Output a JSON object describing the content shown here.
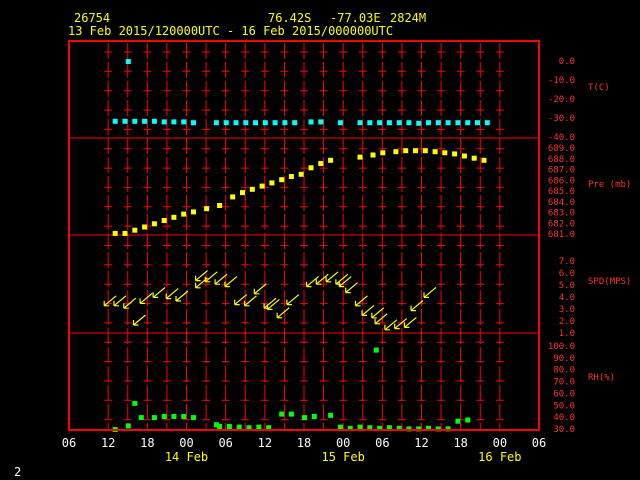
{
  "header": {
    "station_id": "26754",
    "lat": "76.42S",
    "lon": "-77.03E",
    "elev": "2824M",
    "time_range": "13 Feb 2015/120000UTC - 16 Feb 2015/000000UTC"
  },
  "footer": {
    "page_number": "2"
  },
  "colors": {
    "background": "#000000",
    "frame": "#ff0000",
    "labels": "#ff3030",
    "temperature": "#00ffff",
    "pressure": "#ffff00",
    "wind": "#ffff00",
    "humidity": "#00ff00",
    "header": "#ffff00",
    "x_ticks": "#ffffff"
  },
  "chart_data": {
    "type": "scatter",
    "x_tick_labels": [
      "06",
      "12",
      "18",
      "00",
      "06",
      "12",
      "18",
      "00",
      "06",
      "12",
      "18",
      "00",
      "06"
    ],
    "x_tick_hours": [
      6,
      12,
      18,
      24,
      30,
      36,
      42,
      48,
      54,
      60,
      66,
      72,
      78
    ],
    "x_units": "hours since 13 Feb 2015 00UTC",
    "date_labels": [
      {
        "text": "14 Feb",
        "hour": 24
      },
      {
        "text": "15 Feb",
        "hour": 48
      },
      {
        "text": "16 Feb",
        "hour": 72
      }
    ],
    "grid_hours": [
      12,
      15,
      18,
      21,
      24,
      27,
      30,
      33,
      36,
      39,
      42,
      45,
      48,
      51,
      54,
      57,
      60,
      63,
      66,
      69,
      72
    ],
    "panels": [
      {
        "key": "temperature",
        "label": "T(C)",
        "ticks": [
          "0.0",
          "-10.0",
          "-20.0",
          "-30.0",
          "-40.0"
        ],
        "ylim": [
          -40,
          0
        ],
        "marker": "square",
        "points": [
          {
            "x": 15,
            "y": 0
          },
          {
            "x": 13,
            "y": -31.5
          },
          {
            "x": 14.5,
            "y": -31.5
          },
          {
            "x": 16,
            "y": -31.5
          },
          {
            "x": 17.5,
            "y": -31.5
          },
          {
            "x": 19,
            "y": -31.5
          },
          {
            "x": 20.5,
            "y": -31.8
          },
          {
            "x": 22,
            "y": -31.8
          },
          {
            "x": 23.5,
            "y": -31.8
          },
          {
            "x": 25,
            "y": -32.2
          },
          {
            "x": 28.5,
            "y": -32.2
          },
          {
            "x": 30,
            "y": -32.2
          },
          {
            "x": 31.5,
            "y": -32.2
          },
          {
            "x": 33,
            "y": -32.2
          },
          {
            "x": 34.5,
            "y": -32.2
          },
          {
            "x": 36,
            "y": -32.2
          },
          {
            "x": 37.5,
            "y": -32.2
          },
          {
            "x": 39,
            "y": -32.2
          },
          {
            "x": 40.5,
            "y": -32.2
          },
          {
            "x": 43,
            "y": -31.8
          },
          {
            "x": 44.5,
            "y": -31.8
          },
          {
            "x": 47.5,
            "y": -32.2
          },
          {
            "x": 50.5,
            "y": -32.2
          },
          {
            "x": 52,
            "y": -32.2
          },
          {
            "x": 53.5,
            "y": -32.2
          },
          {
            "x": 55,
            "y": -32.2
          },
          {
            "x": 56.5,
            "y": -32.2
          },
          {
            "x": 58,
            "y": -32.2
          },
          {
            "x": 59.5,
            "y": -32.5
          },
          {
            "x": 61,
            "y": -32.2
          },
          {
            "x": 62.5,
            "y": -32.2
          },
          {
            "x": 64,
            "y": -32.2
          },
          {
            "x": 65.5,
            "y": -32.2
          },
          {
            "x": 67,
            "y": -32.2
          },
          {
            "x": 68.5,
            "y": -32.2
          },
          {
            "x": 70,
            "y": -32.2
          }
        ]
      },
      {
        "key": "pressure",
        "label": "Pre (mb)",
        "ticks": [
          "689.0",
          "688.0",
          "687.0",
          "686.0",
          "685.0",
          "684.0",
          "683.0",
          "682.0",
          "681.0"
        ],
        "ylim": [
          681,
          689
        ],
        "marker": "square",
        "points": [
          {
            "x": 13,
            "y": 681.1
          },
          {
            "x": 14.5,
            "y": 681.1
          },
          {
            "x": 16,
            "y": 681.4
          },
          {
            "x": 17.5,
            "y": 681.7
          },
          {
            "x": 19,
            "y": 682.0
          },
          {
            "x": 20.5,
            "y": 682.3
          },
          {
            "x": 22,
            "y": 682.6
          },
          {
            "x": 23.5,
            "y": 682.9
          },
          {
            "x": 25,
            "y": 683.1
          },
          {
            "x": 27,
            "y": 683.4
          },
          {
            "x": 29,
            "y": 683.7
          },
          {
            "x": 31,
            "y": 684.5
          },
          {
            "x": 32.5,
            "y": 684.9
          },
          {
            "x": 34,
            "y": 685.2
          },
          {
            "x": 35.5,
            "y": 685.5
          },
          {
            "x": 37,
            "y": 685.8
          },
          {
            "x": 38.5,
            "y": 686.1
          },
          {
            "x": 40,
            "y": 686.4
          },
          {
            "x": 41.5,
            "y": 686.6
          },
          {
            "x": 43,
            "y": 687.2
          },
          {
            "x": 44.5,
            "y": 687.6
          },
          {
            "x": 46,
            "y": 687.9
          },
          {
            "x": 50.5,
            "y": 688.2
          },
          {
            "x": 52.5,
            "y": 688.4
          },
          {
            "x": 54,
            "y": 688.6
          },
          {
            "x": 56,
            "y": 688.7
          },
          {
            "x": 57.5,
            "y": 688.8
          },
          {
            "x": 59,
            "y": 688.8
          },
          {
            "x": 60.5,
            "y": 688.8
          },
          {
            "x": 62,
            "y": 688.7
          },
          {
            "x": 63.5,
            "y": 688.6
          },
          {
            "x": 65,
            "y": 688.5
          },
          {
            "x": 66.5,
            "y": 688.3
          },
          {
            "x": 68,
            "y": 688.1
          },
          {
            "x": 69.5,
            "y": 687.9
          }
        ]
      },
      {
        "key": "wind",
        "label": "SPD(MPS)",
        "ticks": [
          "7.0",
          "6.0",
          "5.0",
          "4.0",
          "3.0",
          "2.0",
          "1.0"
        ],
        "ylim": [
          1,
          8
        ],
        "marker": "arrow",
        "points": [
          {
            "x": 12,
            "y": 3.6
          },
          {
            "x": 13.5,
            "y": 3.6
          },
          {
            "x": 15,
            "y": 3.4
          },
          {
            "x": 16.5,
            "y": 2.0
          },
          {
            "x": 17.5,
            "y": 3.8
          },
          {
            "x": 19.5,
            "y": 4.3
          },
          {
            "x": 21.5,
            "y": 4.2
          },
          {
            "x": 23,
            "y": 4.0
          },
          {
            "x": 26,
            "y": 5.7
          },
          {
            "x": 26,
            "y": 5.1
          },
          {
            "x": 27.5,
            "y": 5.6
          },
          {
            "x": 29,
            "y": 5.4
          },
          {
            "x": 30.5,
            "y": 5.2
          },
          {
            "x": 32,
            "y": 3.7
          },
          {
            "x": 33.5,
            "y": 3.6
          },
          {
            "x": 35,
            "y": 4.6
          },
          {
            "x": 36.5,
            "y": 3.4
          },
          {
            "x": 37,
            "y": 3.3
          },
          {
            "x": 38.5,
            "y": 2.6
          },
          {
            "x": 40,
            "y": 3.7
          },
          {
            "x": 43,
            "y": 5.2
          },
          {
            "x": 44.5,
            "y": 5.4
          },
          {
            "x": 46,
            "y": 5.6
          },
          {
            "x": 47.5,
            "y": 5.4
          },
          {
            "x": 48,
            "y": 5.2
          },
          {
            "x": 49,
            "y": 4.7
          },
          {
            "x": 50.5,
            "y": 3.6
          },
          {
            "x": 51.5,
            "y": 2.8
          },
          {
            "x": 53,
            "y": 2.6
          },
          {
            "x": 53.5,
            "y": 2.1
          },
          {
            "x": 55,
            "y": 1.6
          },
          {
            "x": 56.5,
            "y": 1.7
          },
          {
            "x": 58,
            "y": 1.8
          },
          {
            "x": 59,
            "y": 3.2
          },
          {
            "x": 61,
            "y": 4.3
          }
        ]
      },
      {
        "key": "humidity",
        "label": "RH(%)",
        "ticks": [
          "100.0",
          "90.0",
          "80.0",
          "70.0",
          "60.0",
          "50.0",
          "40.0",
          "30.0"
        ],
        "ylim": [
          30,
          100
        ],
        "marker": "square",
        "points": [
          {
            "x": 13,
            "y": 30.0
          },
          {
            "x": 15,
            "y": 33.0
          },
          {
            "x": 16,
            "y": 52.0
          },
          {
            "x": 17,
            "y": 40.0
          },
          {
            "x": 19,
            "y": 40.0
          },
          {
            "x": 20.5,
            "y": 41.0
          },
          {
            "x": 22,
            "y": 41.0
          },
          {
            "x": 23.5,
            "y": 41.0
          },
          {
            "x": 25,
            "y": 40.0
          },
          {
            "x": 28.5,
            "y": 34.0
          },
          {
            "x": 29,
            "y": 32.5
          },
          {
            "x": 30.5,
            "y": 32.5
          },
          {
            "x": 32,
            "y": 32.0
          },
          {
            "x": 33.5,
            "y": 31.5
          },
          {
            "x": 35,
            "y": 32.0
          },
          {
            "x": 36.5,
            "y": 31.5
          },
          {
            "x": 38.5,
            "y": 43.0
          },
          {
            "x": 40,
            "y": 43.0
          },
          {
            "x": 42,
            "y": 40.0
          },
          {
            "x": 43.5,
            "y": 41.0
          },
          {
            "x": 46,
            "y": 42.0
          },
          {
            "x": 47.5,
            "y": 32.0
          },
          {
            "x": 49,
            "y": 31.0
          },
          {
            "x": 50.5,
            "y": 32.0
          },
          {
            "x": 52,
            "y": 31.5
          },
          {
            "x": 53,
            "y": 97.0
          },
          {
            "x": 53.5,
            "y": 31.0
          },
          {
            "x": 55,
            "y": 31.5
          },
          {
            "x": 56.5,
            "y": 31.0
          },
          {
            "x": 58,
            "y": 30.5
          },
          {
            "x": 59.5,
            "y": 30.5
          },
          {
            "x": 61,
            "y": 31.0
          },
          {
            "x": 62.5,
            "y": 30.5
          },
          {
            "x": 64,
            "y": 30.5
          },
          {
            "x": 65.5,
            "y": 37.0
          },
          {
            "x": 67,
            "y": 38.0
          }
        ]
      }
    ]
  }
}
